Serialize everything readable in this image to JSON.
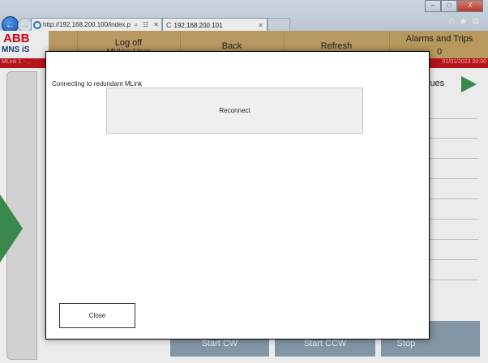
{
  "browser": {
    "address_url": "http://192.168.200.100/index.p",
    "search_glyph": "⌕",
    "compat_glyph": "☷",
    "close_glyph": "✕",
    "tab_title": "192.168.200.101",
    "tab_close": "✕",
    "tab_spinner": "C",
    "back_glyph": "←",
    "forward_glyph": "→",
    "home_glyph": "⌂",
    "favorites_glyph": "★",
    "tools_glyph": "⚙",
    "minimize_glyph": "–",
    "maximize_glyph": "□",
    "window_close_glyph": "X"
  },
  "header": {
    "brand": "ABB",
    "product": "MNS iS",
    "log_off_label": "Log off",
    "log_off_sub": "MView User",
    "back_label": "Back",
    "refresh_label": "Refresh",
    "alarms_title": "Alarms and Trips",
    "alarms_count": "0",
    "status_left": "MLink 1 - ...",
    "status_right": "01/01/2023 00:00"
  },
  "background": {
    "values_label": "lues",
    "start_cw_label": "Start CW",
    "start_ccw_label": "Start CCW",
    "stop_label": "Stop"
  },
  "dialog": {
    "message": "Connecting to redundant MLink",
    "reconnect_label": "Reconnect",
    "close_label": "Close"
  },
  "colors": {
    "header_gold": "#c9a66b",
    "status_red": "#c6161c",
    "nav_green": "#3d9455",
    "button_slate": "#8ea2b3"
  }
}
